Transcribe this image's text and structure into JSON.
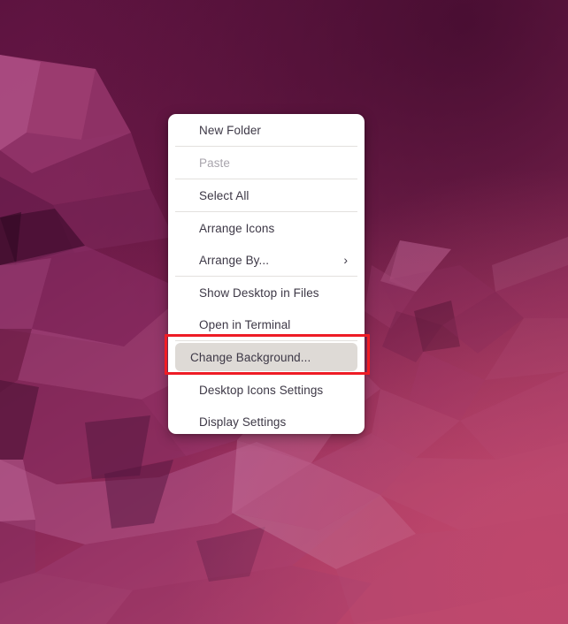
{
  "desktop": {
    "name": "ubuntu-desktop",
    "wallpaper_name": "ubuntu-jammy-low-poly-wallpaper",
    "palette": {
      "bg_dark": "#581240",
      "bg_mid": "#7a1f50",
      "bg_light": "#a8437a",
      "accent_pink": "#b7538c",
      "accent_deep": "#4a0f33",
      "bottom_warm": "#b0406a"
    }
  },
  "context_menu": {
    "name": "desktop-context-menu",
    "background": "#ffffff",
    "text_color": "#3d3846",
    "disabled_color": "#a9a5ad",
    "hover_color": "#dedad6",
    "items": [
      {
        "label": "New Folder",
        "enabled": true,
        "hovered": false,
        "submenu": false,
        "separator_after": true
      },
      {
        "label": "Paste",
        "enabled": false,
        "hovered": false,
        "submenu": false,
        "separator_after": true
      },
      {
        "label": "Select All",
        "enabled": true,
        "hovered": false,
        "submenu": false,
        "separator_after": true
      },
      {
        "label": "Arrange Icons",
        "enabled": true,
        "hovered": false,
        "submenu": false,
        "separator_after": false
      },
      {
        "label": "Arrange By...",
        "enabled": true,
        "hovered": false,
        "submenu": true,
        "separator_after": true
      },
      {
        "label": "Show Desktop in Files",
        "enabled": true,
        "hovered": false,
        "submenu": false,
        "separator_after": false
      },
      {
        "label": "Open in Terminal",
        "enabled": true,
        "hovered": false,
        "submenu": false,
        "separator_after": true
      },
      {
        "label": "Change Background...",
        "enabled": true,
        "hovered": true,
        "submenu": false,
        "separator_after": true
      },
      {
        "label": "Desktop Icons Settings",
        "enabled": true,
        "hovered": false,
        "submenu": false,
        "separator_after": false
      },
      {
        "label": "Display Settings",
        "enabled": true,
        "hovered": false,
        "submenu": false,
        "separator_after": false
      }
    ],
    "submenu_glyph": "›"
  },
  "annotation": {
    "name": "red-highlight-box",
    "color": "#ee1c25",
    "targets_label": "Change Background..."
  }
}
